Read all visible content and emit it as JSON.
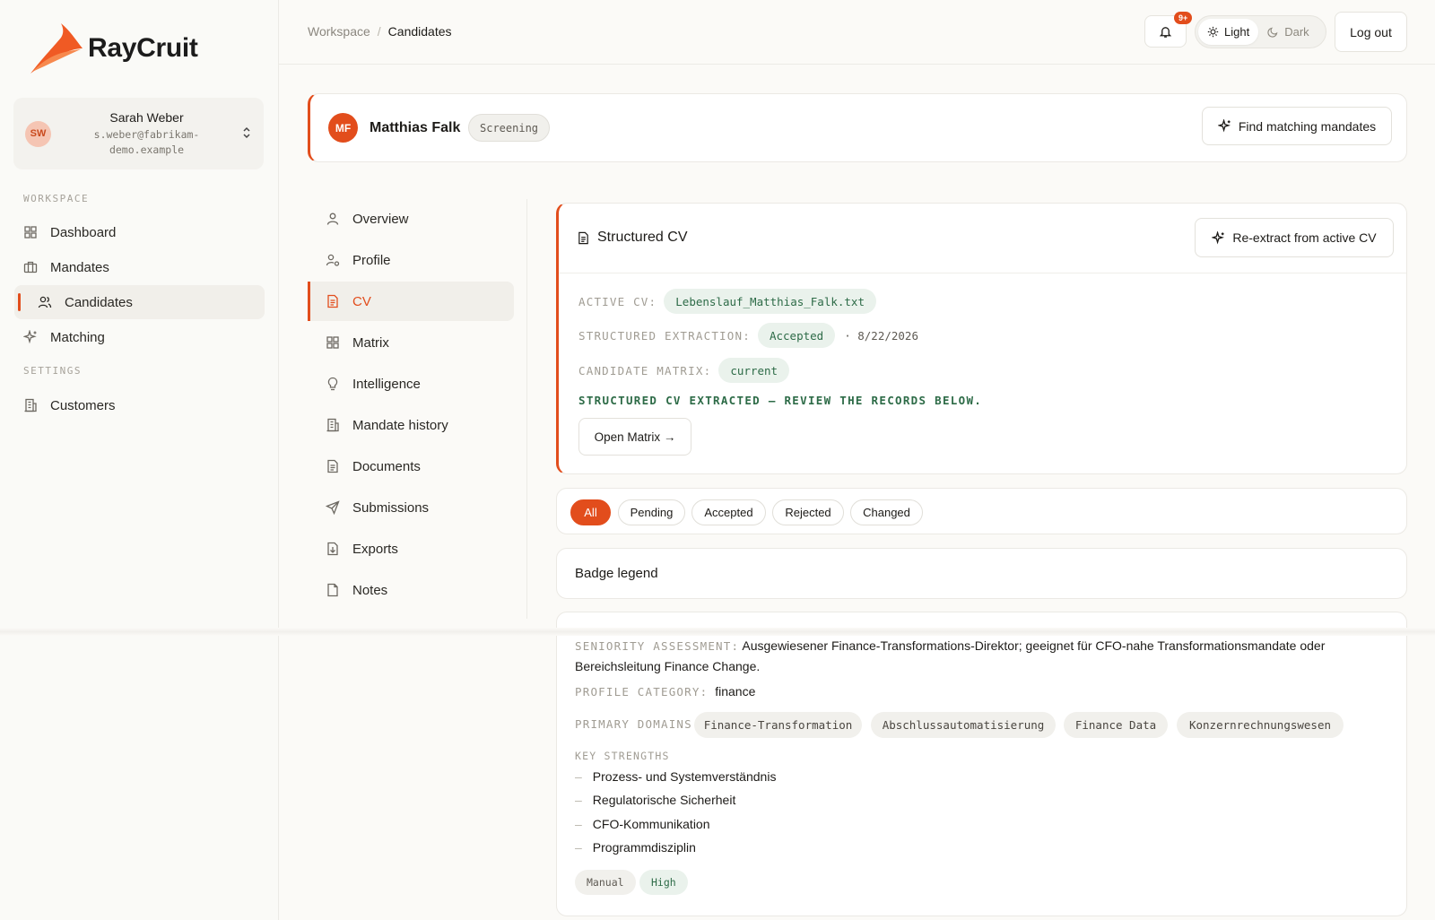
{
  "app": {
    "name": "RayCruit"
  },
  "user": {
    "initials": "SW",
    "name": "Sarah Weber",
    "email_line1": "s.weber@fabrikam-",
    "email_line2": "demo.example"
  },
  "sidebar": {
    "section_workspace": "WORKSPACE",
    "section_settings": "SETTINGS",
    "items": [
      {
        "label": "Dashboard",
        "icon": "grid-icon"
      },
      {
        "label": "Mandates",
        "icon": "briefcase-icon"
      },
      {
        "label": "Candidates",
        "icon": "users-icon",
        "active": true
      },
      {
        "label": "Matching",
        "icon": "sparkle-icon"
      },
      {
        "label": "Customers",
        "icon": "building-icon"
      }
    ]
  },
  "topbar": {
    "breadcrumb_root": "Workspace",
    "breadcrumb_sep": "/",
    "breadcrumb_current": "Candidates",
    "notification_count": "9+",
    "theme_light": "Light",
    "theme_dark": "Dark",
    "logout": "Log out"
  },
  "candidate": {
    "initials": "MF",
    "name": "Matthias Falk",
    "status": "Screening",
    "find_mandates": "Find matching mandates"
  },
  "subnav": {
    "items": [
      {
        "label": "Overview",
        "icon": "user-icon"
      },
      {
        "label": "Profile",
        "icon": "user-cog-icon"
      },
      {
        "label": "CV",
        "icon": "document-icon",
        "active": true
      },
      {
        "label": "Matrix",
        "icon": "grid-icon"
      },
      {
        "label": "Intelligence",
        "icon": "lightbulb-icon"
      },
      {
        "label": "Mandate history",
        "icon": "building-icon"
      },
      {
        "label": "Documents",
        "icon": "document-icon"
      },
      {
        "label": "Submissions",
        "icon": "send-icon"
      },
      {
        "label": "Exports",
        "icon": "file-export-icon"
      },
      {
        "label": "Notes",
        "icon": "note-icon"
      }
    ]
  },
  "cv": {
    "title": "Structured CV",
    "reextract": "Re-extract from active CV",
    "active_cv_label": "ACTIVE CV:",
    "active_cv_value": "Lebenslauf_Matthias_Falk.txt",
    "extraction_label": "STRUCTURED EXTRACTION:",
    "extraction_value": "Accepted",
    "extraction_date": "· 8/22/2026",
    "matrix_label": "CANDIDATE MATRIX:",
    "matrix_value": "current",
    "message": "STRUCTURED CV EXTRACTED — REVIEW THE RECORDS BELOW.",
    "open_matrix": "Open Matrix →"
  },
  "filters": {
    "items": [
      "All",
      "Pending",
      "Accepted",
      "Rejected",
      "Changed"
    ],
    "active": "All"
  },
  "legend": {
    "title": "Badge legend"
  },
  "details": {
    "seniority_label": "SENIORITY ASSESSMENT:",
    "seniority_line1": "Ausgewiesener Finance-Transformations-Direktor; geeignet für CFO-nahe Transformationsmandate oder",
    "seniority_line2": "Bereichsleitung Finance Change.",
    "category_label": "PROFILE CATEGORY:",
    "category_value": "finance",
    "domains_label": "PRIMARY DOMAINS:",
    "domains": [
      "Finance-Transformation",
      "Abschlussautomatisierung",
      "Finance Data",
      "Konzernrechnungswesen"
    ],
    "strengths_label": "KEY STRENGTHS",
    "strengths": [
      "Prozess- und Systemverständnis",
      "Regulatorische Sicherheit",
      "CFO-Kommunikation",
      "Programmdisziplin"
    ],
    "badge_source": "Manual",
    "badge_confidence": "High"
  },
  "colors": {
    "accent": "#e24d1c",
    "success_text": "#2d6b47",
    "success_bg": "#eaf2ec"
  }
}
